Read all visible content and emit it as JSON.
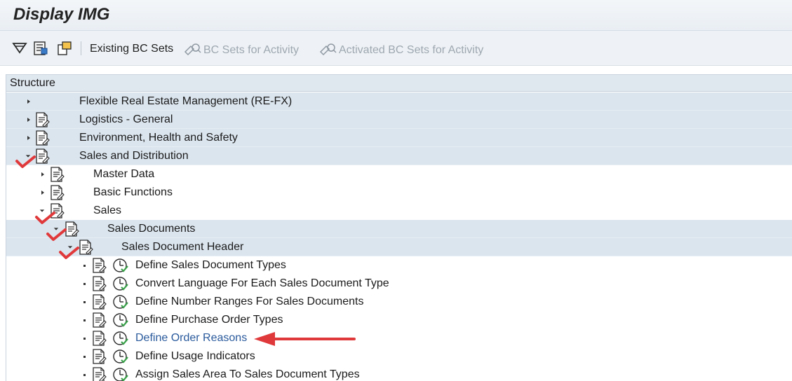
{
  "window": {
    "title": "Display IMG"
  },
  "toolbar": {
    "existing_bc_sets": "Existing BC Sets",
    "bc_sets_for_activity": "BC Sets for Activity",
    "activated_bc_sets_for_activity": "Activated BC Sets for Activity"
  },
  "structure": {
    "header": "Structure",
    "nodes": [
      {
        "label": "Flexible Real Estate Management (RE-FX)"
      },
      {
        "label": "Logistics - General"
      },
      {
        "label": "Environment, Health and Safety"
      },
      {
        "label": "Sales and Distribution"
      },
      {
        "label": "Master Data"
      },
      {
        "label": "Basic Functions"
      },
      {
        "label": "Sales"
      },
      {
        "label": "Sales Documents"
      },
      {
        "label": "Sales Document Header"
      },
      {
        "label": "Define Sales Document Types"
      },
      {
        "label": "Convert Language For Each Sales Document Type"
      },
      {
        "label": "Define Number Ranges For Sales Documents"
      },
      {
        "label": "Define Purchase Order Types"
      },
      {
        "label": "Define Order Reasons"
      },
      {
        "label": "Define Usage Indicators"
      },
      {
        "label": "Assign Sales Area To Sales Document Types"
      }
    ]
  },
  "colors": {
    "accent_link": "#2a5a9c",
    "row_highlight": "#dbe5ee",
    "annotation_red": "#e0393b",
    "disabled_text": "#9ea7b0"
  }
}
